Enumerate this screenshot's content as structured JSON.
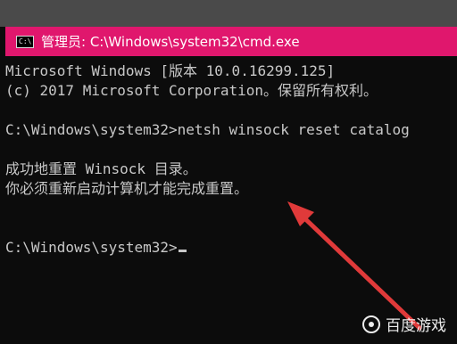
{
  "window": {
    "title": "管理员: C:\\Windows\\system32\\cmd.exe",
    "icon_name": "cmd-icon",
    "icon_text": "C:\\",
    "title_bar_color": "#e0176d"
  },
  "console": {
    "lines": [
      "Microsoft Windows [版本 10.0.16299.125]",
      "(c) 2017 Microsoft Corporation。保留所有权利。",
      "",
      "C:\\Windows\\system32>netsh winsock reset catalog",
      "",
      "成功地重置 Winsock 目录。",
      "你必须重新启动计算机才能完成重置。",
      "",
      "",
      "C:\\Windows\\system32>"
    ],
    "text_color": "#c8c8c8",
    "background_color": "#0c0c0c"
  },
  "annotation": {
    "arrow_color": "#e03a3a",
    "icon_name": "red-arrow-icon"
  },
  "watermark": {
    "text": "百度游戏",
    "icon_name": "baidu-logo-icon"
  }
}
